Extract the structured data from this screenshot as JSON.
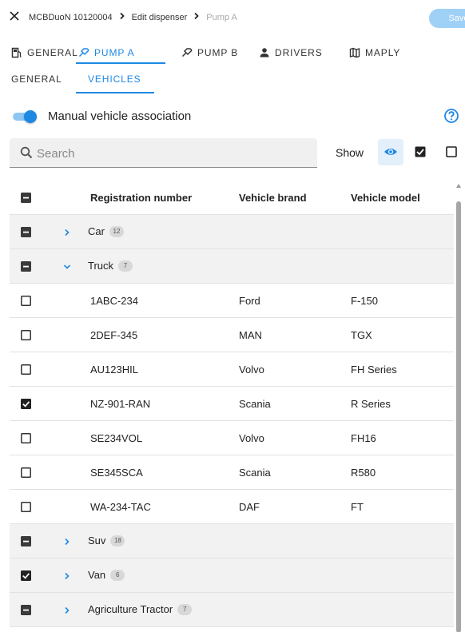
{
  "topbar": {
    "breadcrumb": [
      "MCBDuoN 10120004",
      "Edit dispenser",
      "Pump A"
    ],
    "save_label": "Save"
  },
  "main_tabs": [
    {
      "label": "GENERAL",
      "icon": "gas-station-icon"
    },
    {
      "label": "PUMP A",
      "icon": "pump-nozzle-icon"
    },
    {
      "label": "PUMP B",
      "icon": "pump-nozzle-icon"
    },
    {
      "label": "DRIVERS",
      "icon": "person-icon"
    },
    {
      "label": "MAPLY",
      "icon": "map-icon"
    }
  ],
  "active_main_tab": "PUMP A",
  "sub_tabs": [
    {
      "label": "GENERAL"
    },
    {
      "label": "VEHICLES"
    }
  ],
  "active_sub_tab": "VEHICLES",
  "manual_association": {
    "label": "Manual vehicle association",
    "enabled": true
  },
  "search": {
    "placeholder": "Search",
    "value": ""
  },
  "show_filter": {
    "label": "Show",
    "options": [
      "all-visible",
      "checked",
      "unchecked"
    ],
    "selected": "all-visible"
  },
  "table": {
    "headers": {
      "registration": "Registration number",
      "brand": "Vehicle brand",
      "model": "Vehicle model"
    },
    "rows": [
      {
        "type": "group",
        "name": "Car",
        "count": "12",
        "expanded": false,
        "check": "indeterminate"
      },
      {
        "type": "group",
        "name": "Truck",
        "count": "7",
        "expanded": true,
        "check": "indeterminate"
      },
      {
        "type": "vehicle",
        "registration": "1ABC-234",
        "brand": "Ford",
        "model": "F-150",
        "checked": false
      },
      {
        "type": "vehicle",
        "registration": "2DEF-345",
        "brand": "MAN",
        "model": "TGX",
        "checked": false
      },
      {
        "type": "vehicle",
        "registration": "AU123HIL",
        "brand": "Volvo",
        "model": "FH Series",
        "checked": false
      },
      {
        "type": "vehicle",
        "registration": "NZ-901-RAN",
        "brand": "Scania",
        "model": "R Series",
        "checked": true
      },
      {
        "type": "vehicle",
        "registration": "SE234VOL",
        "brand": "Volvo",
        "model": "FH16",
        "checked": false
      },
      {
        "type": "vehicle",
        "registration": "SE345SCA",
        "brand": "Scania",
        "model": "R580",
        "checked": false
      },
      {
        "type": "vehicle",
        "registration": "WA-234-TAC",
        "brand": "DAF",
        "model": "FT",
        "checked": false
      },
      {
        "type": "group",
        "name": "Suv",
        "count": "18",
        "expanded": false,
        "check": "indeterminate"
      },
      {
        "type": "group",
        "name": "Van",
        "count": "6",
        "expanded": false,
        "check": "checked"
      },
      {
        "type": "group",
        "name": "Agriculture Tractor",
        "count": "7",
        "expanded": false,
        "check": "indeterminate"
      }
    ]
  },
  "colors": {
    "accent": "#1e88e5",
    "save_button": "#9fd0f6",
    "group_row_bg": "#f2f2f2"
  }
}
